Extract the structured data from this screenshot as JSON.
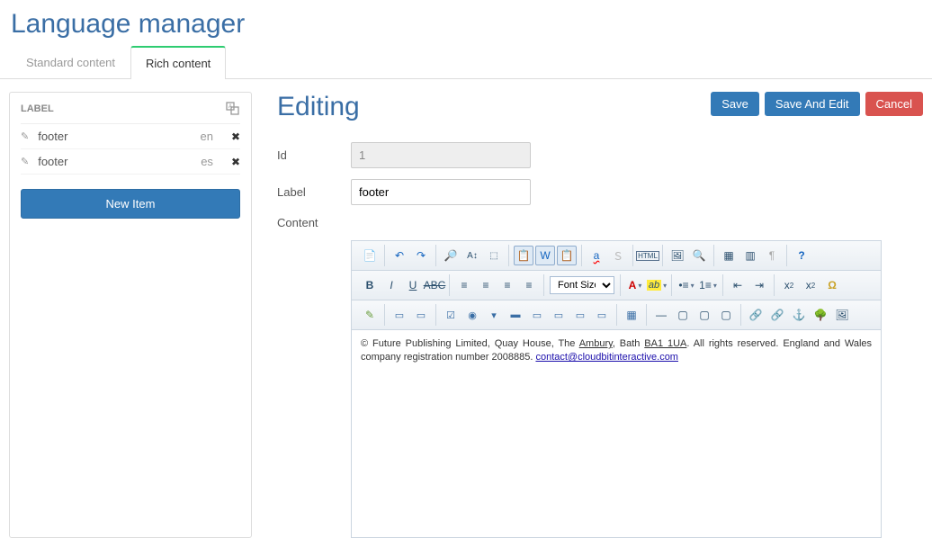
{
  "page_title": "Language manager",
  "tabs": [
    {
      "label": "Standard content",
      "active": false
    },
    {
      "label": "Rich content",
      "active": true
    }
  ],
  "sidebar": {
    "header": "LABEL",
    "items": [
      {
        "label": "footer",
        "lang": "en"
      },
      {
        "label": "footer",
        "lang": "es"
      }
    ],
    "new_button": "New Item"
  },
  "editing": {
    "heading": "Editing",
    "buttons": {
      "save": "Save",
      "save_edit": "Save And Edit",
      "cancel": "Cancel"
    },
    "fields": {
      "id_label": "Id",
      "id_value": "1",
      "label_label": "Label",
      "label_value": "footer",
      "content_label": "Content"
    }
  },
  "editor": {
    "font_size_label": "Font Size",
    "body_plain": "© Future Publishing Limited, Quay House, The ",
    "body_link1": "Ambury",
    "body_mid": ", Bath ",
    "body_link2": "BA1 1UA",
    "body_tail": ". All rights reserved. England and Wales company registration number 2008885. ",
    "body_email": "contact@cloudbitinteractive.com"
  }
}
